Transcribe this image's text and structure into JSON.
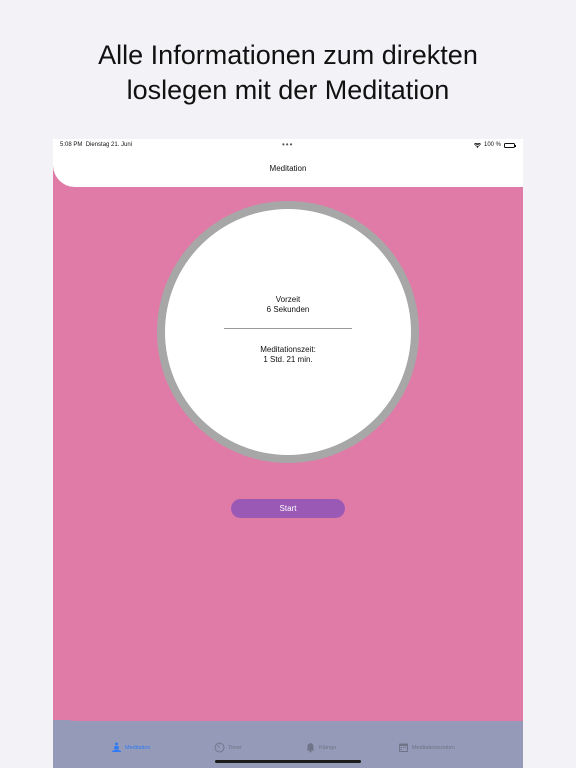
{
  "headline": {
    "line1": "Alle Informationen zum direkten",
    "line2": "loslegen mit der Meditation"
  },
  "status_bar": {
    "time": "5:08 PM",
    "date": "Dienstag 21. Juni",
    "battery": "100 %",
    "dots": "•••"
  },
  "nav": {
    "title": "Meditation"
  },
  "timer": {
    "pre_label": "Vorzeit",
    "pre_value": "6 Sekunden",
    "med_label": "Meditationszeit:",
    "med_value": "1 Std. 21 min."
  },
  "start_label": "Start",
  "tabs": [
    {
      "label": "Meditation",
      "icon": "meditation-icon",
      "active": true
    },
    {
      "label": "Timer",
      "icon": "timer-icon",
      "active": false
    },
    {
      "label": "Klänge",
      "icon": "bell-icon",
      "active": false
    },
    {
      "label": "Meditationszeiten",
      "icon": "calendar-icon",
      "active": false
    }
  ],
  "colors": {
    "background": "#f2f2f7",
    "pink": "#e07ba7",
    "tabbar": "#949ab7",
    "start_button": "#9b59b6",
    "active_tab": "#2f7bf5",
    "ring": "#a7a7a7"
  }
}
